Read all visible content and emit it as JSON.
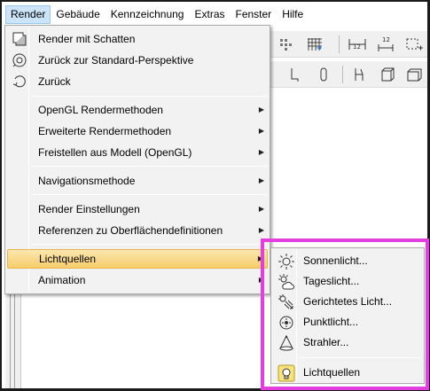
{
  "menubar": {
    "items": [
      "Render",
      "Gebäude",
      "Kennzeichnung",
      "Extras",
      "Fenster",
      "Hilfe"
    ]
  },
  "render_menu": {
    "items": [
      {
        "label": "Render mit Schatten",
        "icon": "render-shadow-icon"
      },
      {
        "label": "Zurück zur Standard-Perspektive",
        "icon": "standard-perspective-icon"
      },
      {
        "label": "Zurück",
        "icon": "back-icon"
      },
      {
        "label": "OpenGL Rendermethoden",
        "has_submenu": true
      },
      {
        "label": "Erweiterte Rendermethoden",
        "has_submenu": true
      },
      {
        "label": "Freistellen aus Modell (OpenGL)",
        "has_submenu": true
      },
      {
        "label": "Navigationsmethode",
        "has_submenu": true
      },
      {
        "label": "Render Einstellungen",
        "has_submenu": true
      },
      {
        "label": "Referenzen zu Oberflächendefinitionen",
        "has_submenu": true
      },
      {
        "label": "Lichtquellen",
        "has_submenu": true,
        "highlighted": true
      },
      {
        "label": "Animation",
        "has_submenu": true
      }
    ]
  },
  "lichtquellen_submenu": {
    "items": [
      {
        "label": "Sonnenlicht...",
        "icon": "sun-icon"
      },
      {
        "label": "Tageslicht...",
        "icon": "daylight-icon"
      },
      {
        "label": "Gerichtetes Licht...",
        "icon": "directional-light-icon"
      },
      {
        "label": "Punktlicht...",
        "icon": "point-light-icon"
      },
      {
        "label": "Strahler...",
        "icon": "spotlight-icon"
      },
      {
        "label": "Lichtquellen",
        "icon": "light-sources-icon"
      }
    ]
  },
  "colors": {
    "highlight_box": "#e53ee0",
    "hover_gradient_top": "#fbe7b0",
    "hover_gradient_bottom": "#f6cd6a",
    "menubar_active": "#cce4f7"
  }
}
